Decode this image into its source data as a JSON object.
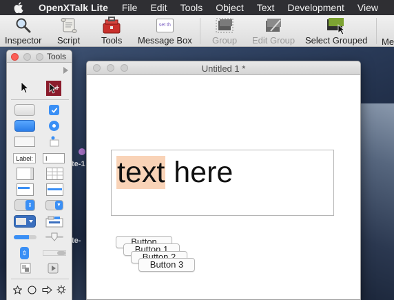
{
  "menubar": {
    "app_name": "OpenXTalk Lite",
    "items": [
      "File",
      "Edit",
      "Tools",
      "Object",
      "Text",
      "Development",
      "View"
    ]
  },
  "toolbar": {
    "buttons": [
      {
        "label": "Inspector",
        "icon": "magnifier-icon",
        "enabled": true
      },
      {
        "label": "Script",
        "icon": "scroll-icon",
        "enabled": true
      },
      {
        "label": "Tools",
        "icon": "toolbox-icon",
        "enabled": true
      },
      {
        "label": "Message Box",
        "icon": "message-box-icon",
        "enabled": true
      },
      {
        "label": "Group",
        "icon": "group-icon",
        "enabled": false
      },
      {
        "label": "Edit Group",
        "icon": "edit-group-icon",
        "enabled": false
      },
      {
        "label": "Select Grouped",
        "icon": "select-grouped-icon",
        "enabled": true
      },
      {
        "label": "Me",
        "icon": "",
        "enabled": true
      }
    ],
    "message_box_icon_text": "set th"
  },
  "palette": {
    "title": "Tools",
    "label_tool_text": "Label:",
    "label_field_text": "I"
  },
  "document": {
    "title": "Untitled 1 *",
    "field": {
      "highlighted": "text",
      "rest": " here"
    },
    "buttons": [
      "Button",
      "Button 1",
      "Button 2",
      "Button 3"
    ]
  },
  "desktop_fragments": [
    "te-1",
    "te-"
  ],
  "colors": {
    "accent": "#3a8ff5",
    "highlight": "#f9d3b7",
    "close": "#fc5f57"
  }
}
